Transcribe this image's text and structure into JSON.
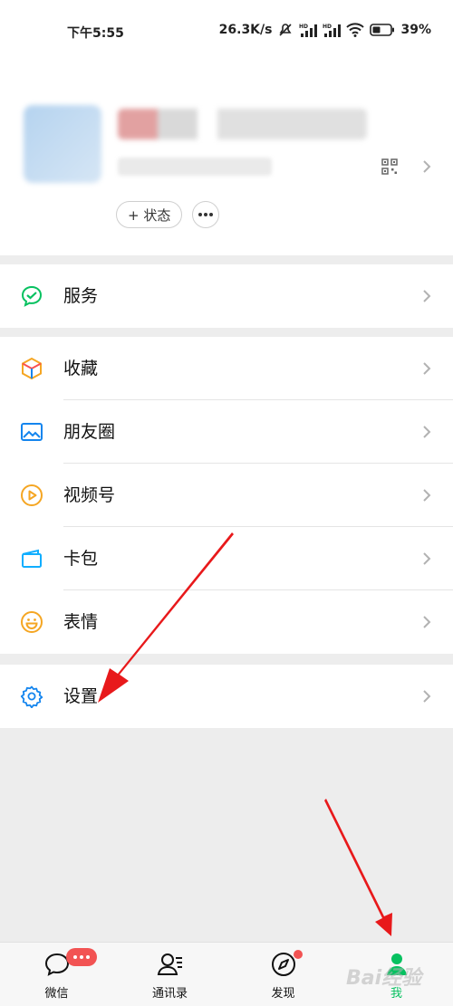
{
  "status_bar": {
    "time": "下午5:55",
    "net_speed": "26.3K/s",
    "battery": "39%"
  },
  "profile": {
    "status_label": "+ 状态"
  },
  "menu": {
    "service": "服务",
    "favorites": "收藏",
    "moments": "朋友圈",
    "channels": "视频号",
    "cards": "卡包",
    "stickers": "表情",
    "settings": "设置"
  },
  "tabs": {
    "chats": "微信",
    "contacts": "通讯录",
    "discover": "发现",
    "me": "我"
  },
  "watermark": "Bai经验",
  "colors": {
    "accent": "#07c160",
    "badge": "#f25353",
    "arrow": "#e8191b"
  }
}
